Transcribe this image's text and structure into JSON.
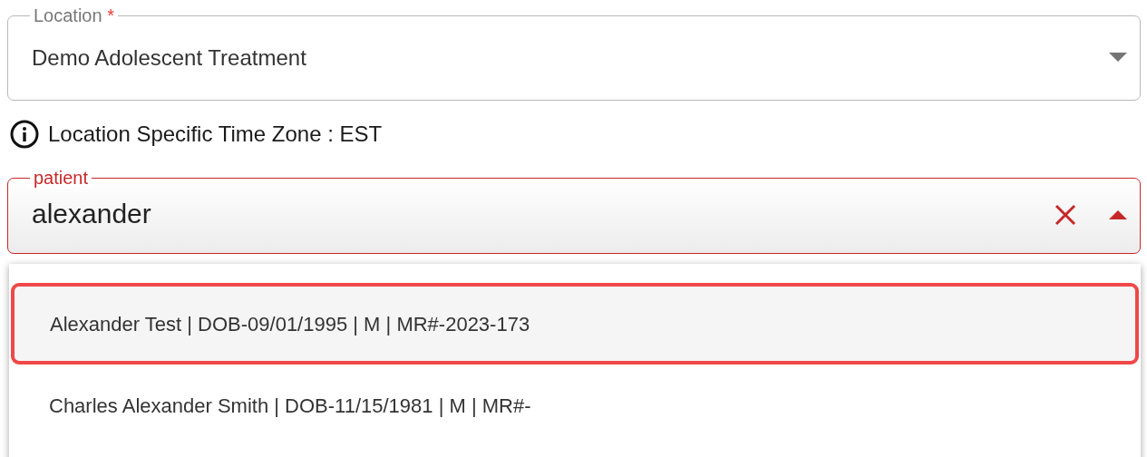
{
  "location_field": {
    "label": "Location",
    "required_mark": "*",
    "value": "Demo Adolescent Treatment",
    "expanded": false
  },
  "time_zone_note": "Location Specific Time Zone : EST",
  "patient_field": {
    "label": "patient",
    "value": "alexander",
    "expanded": true,
    "clear_visible": true
  },
  "options": [
    {
      "text": "Alexander Test | DOB-09/01/1995 | M | MR#-2023-173",
      "selected": true
    },
    {
      "text": "Charles Alexander Smith | DOB-11/15/1981 | M | MR#-",
      "selected": false
    }
  ]
}
